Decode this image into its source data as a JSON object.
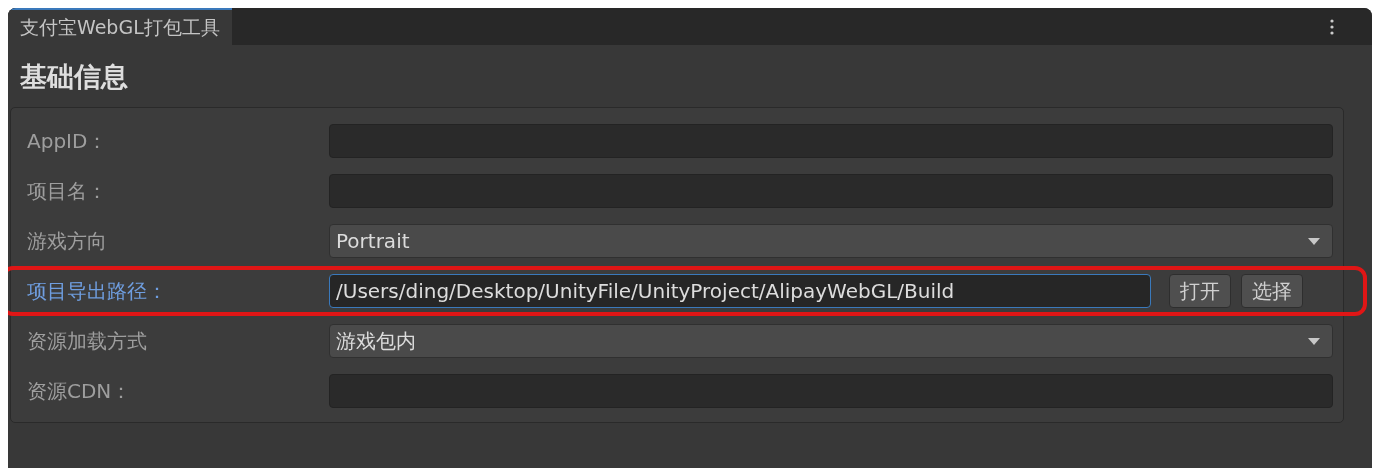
{
  "tabs": [
    {
      "label": "支付宝WebGL打包工具",
      "selected": true
    }
  ],
  "section": {
    "title": "基础信息"
  },
  "fields": [
    {
      "kind": "text",
      "label": "AppID：",
      "focused": false,
      "highlighted": false
    },
    {
      "kind": "text",
      "label": "项目名：",
      "focused": false,
      "highlighted": false
    },
    {
      "kind": "dropdown",
      "label": "游戏方向",
      "value": "Portrait",
      "focused": false,
      "highlighted": false
    },
    {
      "kind": "path",
      "label": "项目导出路径：",
      "value": "/Users/ding/Desktop/UnityFile/UnityProject/AlipayWebGL/Build",
      "focused": true,
      "highlighted": true,
      "buttons": [
        "打开",
        "选择"
      ]
    },
    {
      "kind": "dropdown",
      "label": "资源加载方式",
      "value": "游戏包内",
      "focused": false,
      "highlighted": false
    },
    {
      "kind": "text",
      "label": "资源CDN：",
      "focused": false,
      "highlighted": false
    }
  ]
}
